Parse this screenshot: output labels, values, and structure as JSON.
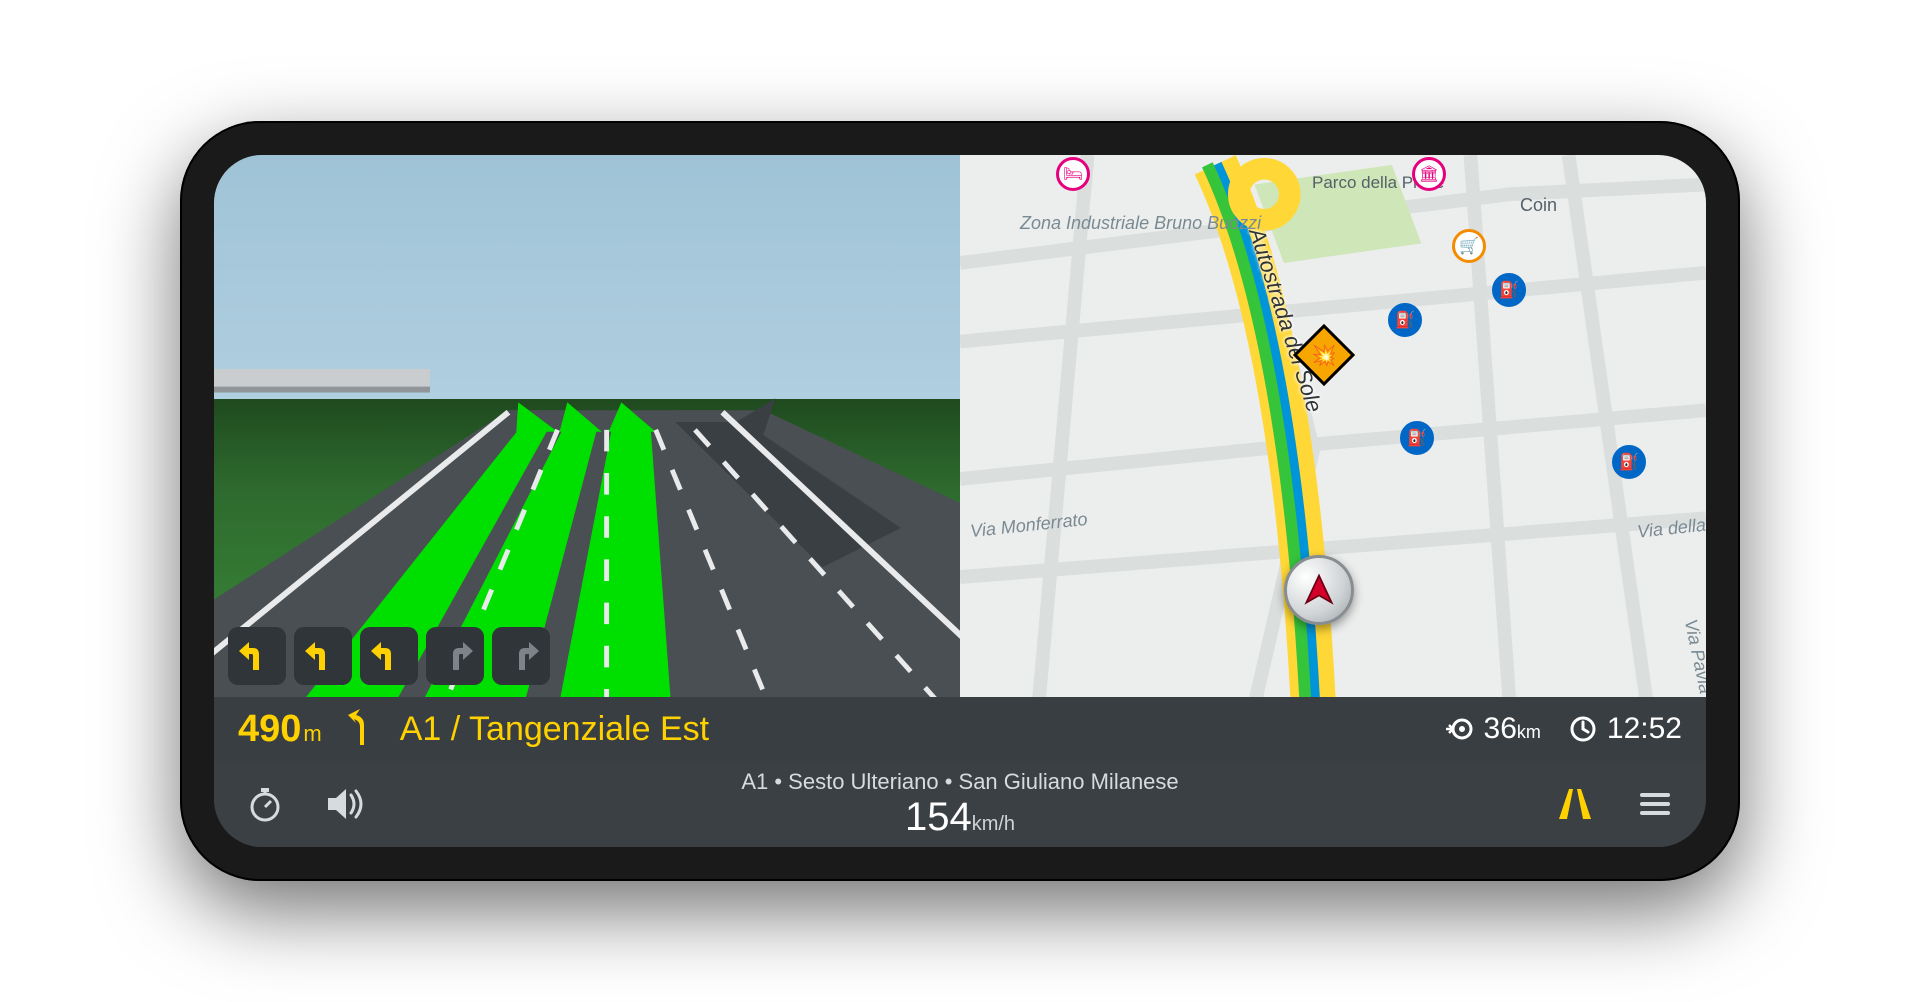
{
  "guidance": {
    "distance_value": "490",
    "distance_unit": "m",
    "destination": "A1 / Tangenziale Est",
    "lanes": [
      {
        "dir": "left",
        "active": true
      },
      {
        "dir": "left",
        "active": true
      },
      {
        "dir": "left",
        "active": true
      },
      {
        "dir": "right",
        "active": false
      },
      {
        "dir": "right",
        "active": false
      }
    ]
  },
  "map": {
    "highway_label": "Autostrada del Sole",
    "labels": {
      "zona": "Zona Industriale Bruno Buozzi",
      "parco": "Parco della Pieve",
      "coin": "Coin",
      "monferrato": "Via Monferrato",
      "liberta": "Via della Libertà",
      "pavia": "Via Pavia"
    },
    "poi": [
      {
        "kind": "hotel",
        "style": "pink",
        "glyph": "🛏"
      },
      {
        "kind": "museum",
        "style": "pink",
        "glyph": "🏛"
      },
      {
        "kind": "shopping",
        "style": "orange",
        "glyph": "🛒"
      },
      {
        "kind": "fuel",
        "style": "blue",
        "glyph": "⛽"
      },
      {
        "kind": "fuel",
        "style": "blue",
        "glyph": "⛽"
      },
      {
        "kind": "fuel",
        "style": "blue",
        "glyph": "⛽"
      },
      {
        "kind": "fuel",
        "style": "blue",
        "glyph": "⛽"
      }
    ],
    "hazard": "⚠"
  },
  "trip": {
    "remaining_km_value": "36",
    "remaining_km_unit": "km",
    "eta": "12:52"
  },
  "status": {
    "location": "A1 • Sesto Ulteriano • San Giuliano Milanese",
    "speed_value": "154",
    "speed_unit": "km/h"
  },
  "colors": {
    "accent": "#ffd100",
    "lane_active": "#00e000"
  }
}
